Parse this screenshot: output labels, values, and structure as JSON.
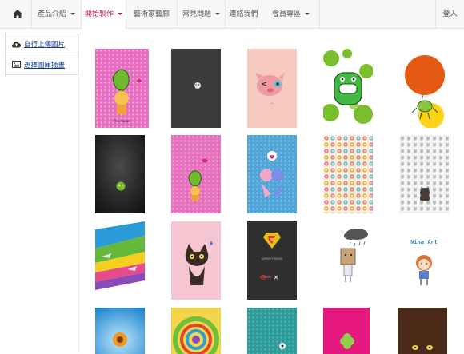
{
  "nav": {
    "items": [
      {
        "label": "產品介紹",
        "dropdown": true,
        "active": false
      },
      {
        "label": "開始製作",
        "dropdown": true,
        "active": true
      },
      {
        "label": "藝術家藝廊",
        "dropdown": false,
        "active": false
      },
      {
        "label": "常見問題",
        "dropdown": true,
        "active": false
      },
      {
        "label": "連絡我們",
        "dropdown": false,
        "active": false
      },
      {
        "label": "會員專區",
        "dropdown": true,
        "active": false
      }
    ],
    "login": "登入"
  },
  "sidebar": {
    "items": [
      {
        "label": "自行上傳圖片",
        "icon": "cloud-upload-icon"
      },
      {
        "label": "選擇圖庫插畫",
        "icon": "picture-icon"
      }
    ]
  },
  "gallery": {
    "tiles": [
      {
        "name": "green-leaf-girl-pink-dots",
        "text": "The Pupas"
      },
      {
        "name": "dark-charcoal-small-icon",
        "text": ""
      },
      {
        "name": "pink-pig-face",
        "text": ""
      },
      {
        "name": "green-monster-circles",
        "text": ""
      },
      {
        "name": "orange-balloon-creature",
        "text": ""
      },
      {
        "name": "dark-metal-green-badge",
        "text": ""
      },
      {
        "name": "pink-dots-leaf-girl",
        "text": ""
      },
      {
        "name": "blue-dots-twin-cats",
        "text": ""
      },
      {
        "name": "colorful-donut-pattern",
        "text": ""
      },
      {
        "name": "gray-cat-pattern",
        "text": ""
      },
      {
        "name": "rainbow-paint-strokes",
        "text": ""
      },
      {
        "name": "black-cat-pink-bg",
        "text": ""
      },
      {
        "name": "superman-logo-dark",
        "text": "SUPER FOREVER"
      },
      {
        "name": "rain-cloud-boxhead",
        "text": ""
      },
      {
        "name": "nina-art-girl",
        "text": "Nina Art"
      },
      {
        "name": "blue-sunflower-rays",
        "text": ""
      },
      {
        "name": "green-yellow-swirl",
        "text": ""
      },
      {
        "name": "teal-dots-figure",
        "text": ""
      },
      {
        "name": "magenta-clover",
        "text": ""
      },
      {
        "name": "brown-peeking-eyes",
        "text": ""
      }
    ]
  }
}
